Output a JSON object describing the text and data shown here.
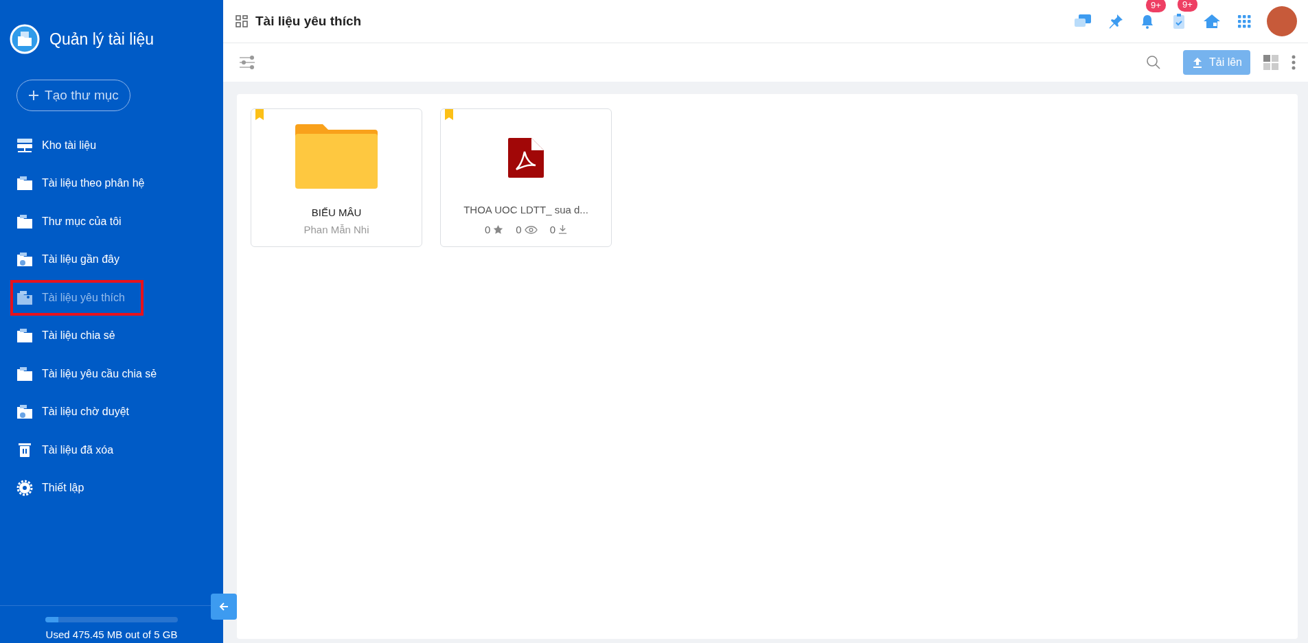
{
  "app": {
    "title": "Quản lý tài liệu"
  },
  "create_button": {
    "label": "Tạo thư mục"
  },
  "sidebar": {
    "items": [
      {
        "label": "Kho tài liệu",
        "kind": "server",
        "selected": false
      },
      {
        "label": "Tài liệu theo phân hệ",
        "kind": "folder",
        "selected": false
      },
      {
        "label": "Thư mục của tôi",
        "kind": "folder",
        "selected": false
      },
      {
        "label": "Tài liệu gần đây",
        "kind": "clock",
        "selected": false
      },
      {
        "label": "Tài liệu yêu thích",
        "kind": "star",
        "selected": true
      },
      {
        "label": "Tài liệu chia sẻ",
        "kind": "folder",
        "selected": false
      },
      {
        "label": "Tài liệu yêu cầu chia sẻ",
        "kind": "folder",
        "selected": false
      },
      {
        "label": "Tài liệu chờ duyệt",
        "kind": "clock",
        "selected": false
      },
      {
        "label": "Tài liệu đã xóa",
        "kind": "trash",
        "selected": false
      },
      {
        "label": "Thiết lập",
        "kind": "gear",
        "selected": false
      }
    ]
  },
  "storage": {
    "level": 0.1,
    "text": "Used 475.45 MB out of 5 GB"
  },
  "header": {
    "title": "Tài liệu yêu thích",
    "notifications_badge": "9+",
    "tasks_badge": "9+"
  },
  "toolbar": {
    "upload_button": "Tải lên"
  },
  "items": [
    {
      "kind": "folder",
      "bookmarked": true,
      "name": "BIẾU MÂU",
      "owner": "Phan Mẫn Nhi"
    },
    {
      "kind": "pdf",
      "bookmarked": true,
      "name": "THOA UOC LDTT_ sua d...",
      "stars": "0",
      "views": "0",
      "downloads": "0"
    }
  ]
}
